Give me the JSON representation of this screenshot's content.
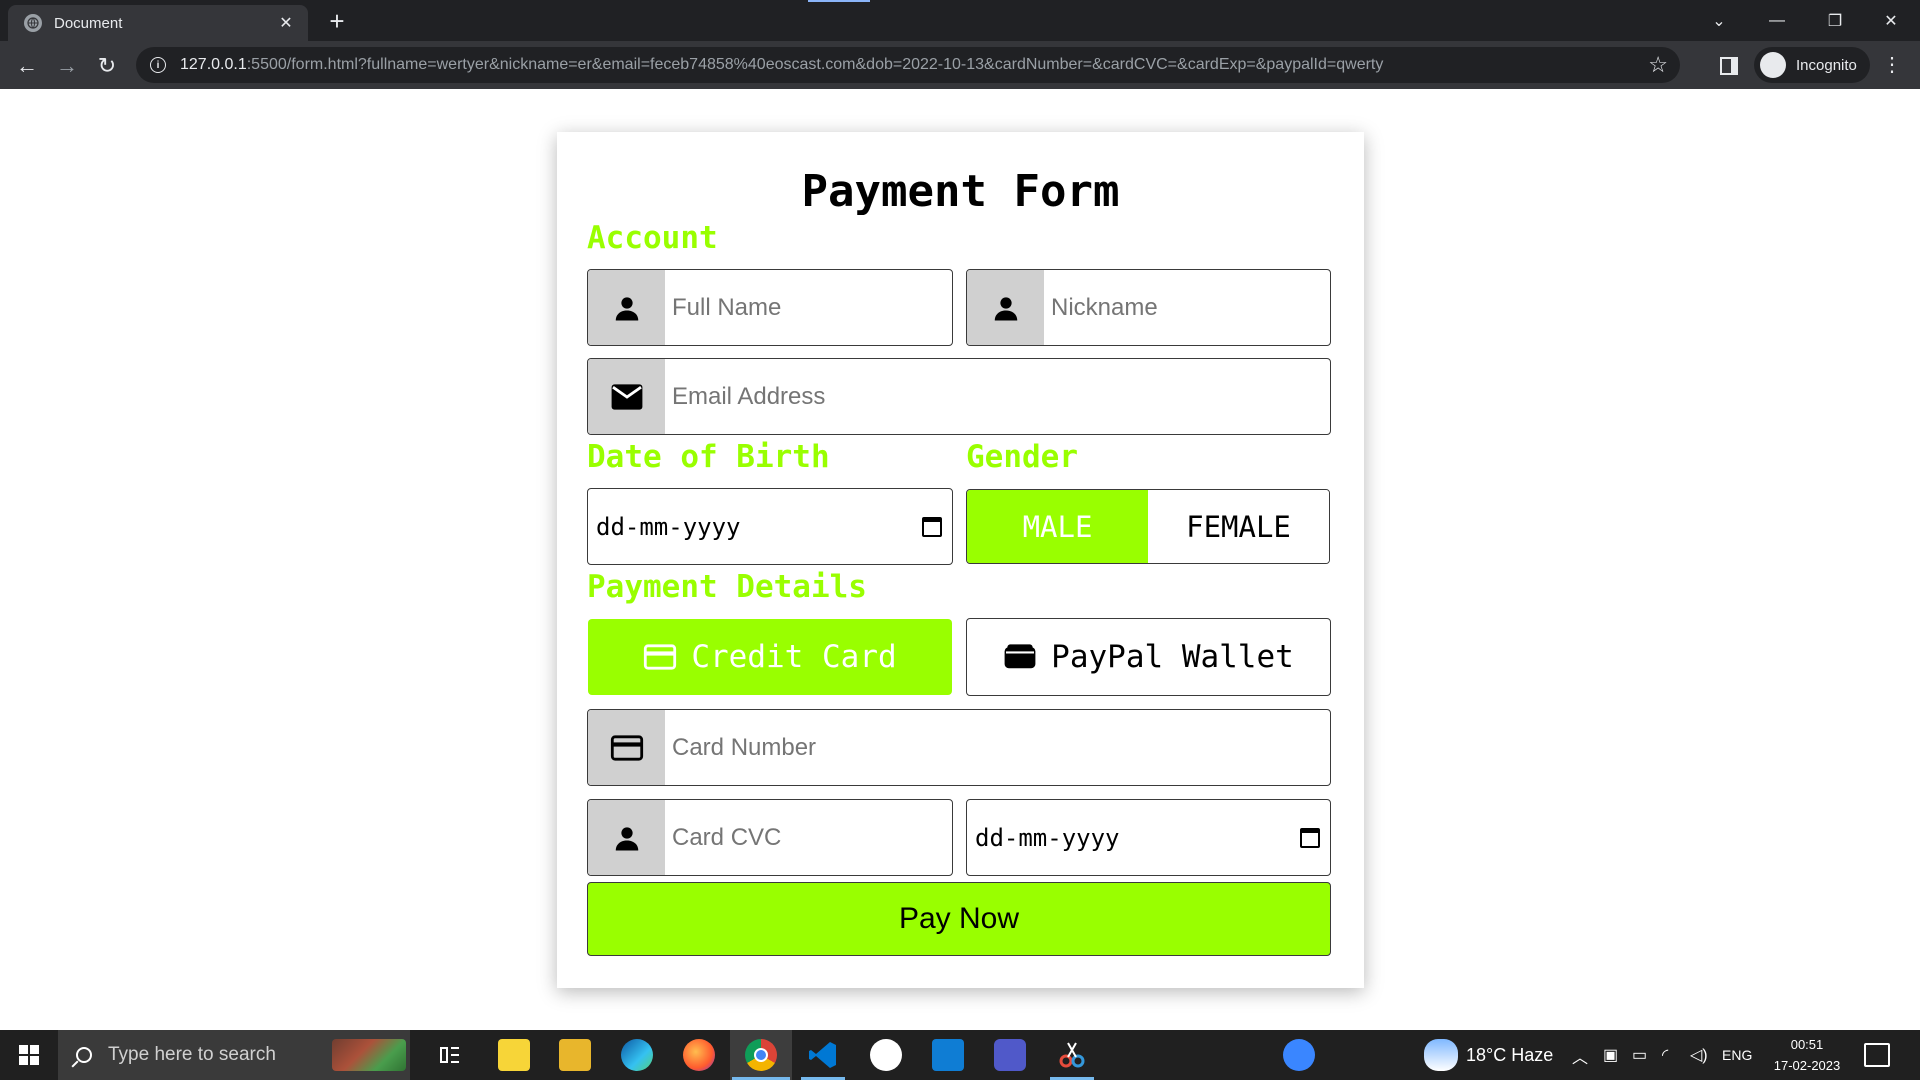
{
  "browser": {
    "tab_title": "Document",
    "tab_close": "✕",
    "new_tab": "+",
    "url_host": "127.0.0.1",
    "url_rest": ":5500/form.html?fullname=wertyer&nickname=er&email=feceb74858%40eoscast.com&dob=2022-10-13&cardNumber=&cardCVC=&cardExp=&paypalId=qwerty",
    "profile_label": "Incognito",
    "nav_back": "←",
    "nav_forward": "→",
    "nav_reload": "↻",
    "star": "☆",
    "minimize": "—",
    "maximize": "❐",
    "close": "✕",
    "tab_list": "⌄",
    "menu": "⋮",
    "info": "i"
  },
  "form": {
    "title": "Payment Form",
    "account_label": "Account",
    "fullname_placeholder": "Full Name",
    "nickname_placeholder": "Nickname",
    "email_placeholder": "Email Address",
    "dob_label": "Date of Birth",
    "dob_value": "dd-mm-yyyy",
    "gender_label": "Gender",
    "gender_options": [
      "MALE",
      "FEMALE"
    ],
    "gender_selected": "MALE",
    "payment_label": "Payment Details",
    "payment_methods": [
      "Credit Card",
      "PayPal Wallet"
    ],
    "payment_selected": "Credit Card",
    "card_number_placeholder": "Card Number",
    "card_cvc_placeholder": "Card CVC",
    "card_exp_value": "dd-mm-yyyy",
    "submit_label": "Pay Now",
    "accent_color": "#99ff00"
  },
  "taskbar": {
    "search_placeholder": "Type here to search",
    "weather": "18°C  Haze",
    "language": "ENG",
    "time": "00:51",
    "date": "17-02-2023"
  }
}
